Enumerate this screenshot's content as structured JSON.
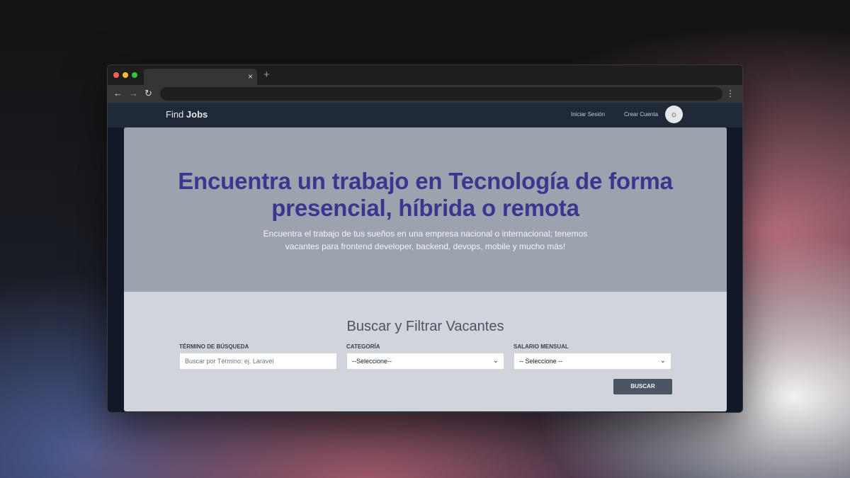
{
  "browser": {
    "tab_close_icon": "×",
    "tab_new_icon": "+",
    "back_icon": "←",
    "forward_icon": "→",
    "reload_icon": "↻",
    "menu_icon": "⋮"
  },
  "site": {
    "brand_prefix": "Find",
    "brand_bold": "Jobs",
    "nav": {
      "login": "Iniciar Sesión",
      "register": "Crear Cuenta",
      "theme_icon": "☼"
    }
  },
  "hero": {
    "title_line1": "Encuentra un trabajo en Tecnología de forma",
    "title_line2": "presencial, híbrida o remota",
    "subtitle": "Encuentra el trabajo de tus sueños en una empresa nacional o internacional; tenemos vacantes para frontend developer, backend, devops, mobile y mucho más!"
  },
  "search": {
    "heading": "Buscar y Filtrar Vacantes",
    "term_label": "TÉRMINO DE BÚSQUEDA",
    "term_placeholder": "Buscar por Término: ej. Laravel",
    "category_label": "CATEGORÍA",
    "category_selected": "--Seleccione--",
    "salary_label": "SALARIO MENSUAL",
    "salary_selected": "-- Seleccione --",
    "button": "BUSCAR"
  },
  "colors": {
    "title": "#3b378f",
    "hero_bg": "#9ca3af",
    "search_bg": "#d1d5db",
    "nav_bg": "#1f2937",
    "button_bg": "#4b5563"
  }
}
